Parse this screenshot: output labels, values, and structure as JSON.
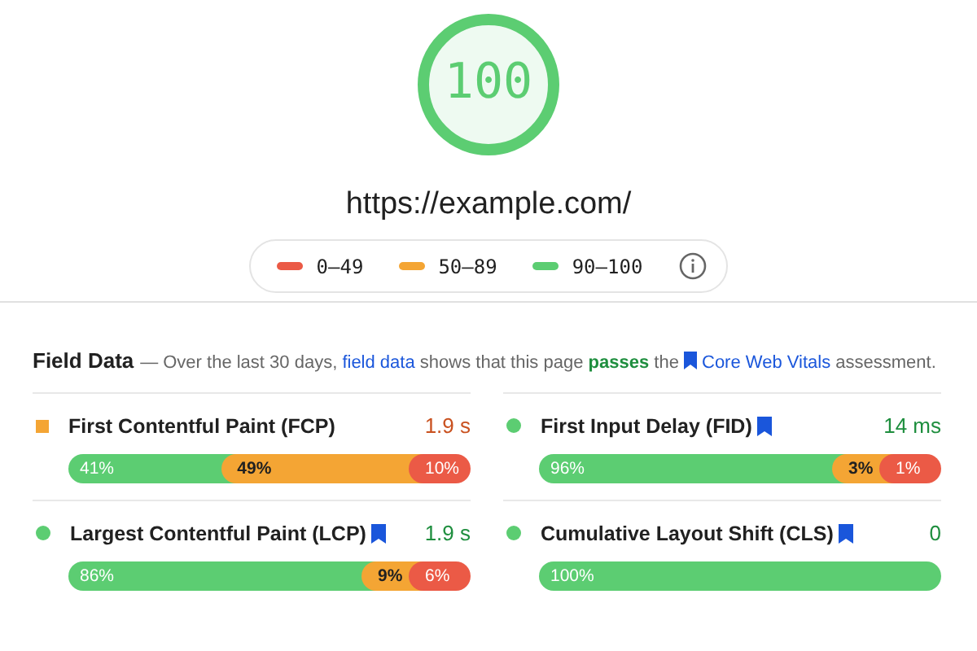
{
  "gauge": {
    "score": "100",
    "level": 1
  },
  "url": "https://example.com/",
  "legend": [
    {
      "label": "0–49",
      "color": "#eb5a46"
    },
    {
      "label": "50–89",
      "color": "#f4a534"
    },
    {
      "label": "90–100",
      "color": "#5ccd72"
    }
  ],
  "field_data": {
    "title": "Field Data",
    "dash": "—",
    "description": [
      {
        "kind": "text",
        "text": "Over the last 30 days,"
      },
      {
        "kind": "link",
        "text": "field data"
      },
      {
        "kind": "text",
        "text": "shows that this page"
      },
      {
        "kind": "pass",
        "text": "passes"
      },
      {
        "kind": "text",
        "text": "the"
      },
      {
        "kind": "cwv",
        "text": "Core Web Vitals"
      },
      {
        "kind": "text",
        "text": "assessment."
      }
    ]
  },
  "metrics": [
    {
      "name": "First Contentful Paint (FCP)",
      "kind": "average",
      "value": "1.9 s",
      "core": false,
      "segments": [
        {
          "kind": "fast",
          "label": "41%"
        },
        {
          "kind": "average",
          "label": "49%"
        },
        {
          "kind": "slow",
          "label": "10%"
        }
      ]
    },
    {
      "name": "First Input Delay (FID)",
      "kind": "fast",
      "value": "14 ms",
      "core": true,
      "segments": [
        {
          "kind": "fast",
          "label": "96%"
        },
        {
          "kind": "average",
          "label": "3%"
        },
        {
          "kind": "slow",
          "label": "1%"
        }
      ]
    },
    {
      "name": "Largest Contentful Paint (LCP)",
      "kind": "fast",
      "value": "1.9 s",
      "core": true,
      "segments": [
        {
          "kind": "fast",
          "label": "86%"
        },
        {
          "kind": "average",
          "label": "9%"
        },
        {
          "kind": "slow",
          "label": "6%"
        }
      ]
    },
    {
      "name": "Cumulative Layout Shift (CLS)",
      "kind": "fast",
      "value": "0",
      "core": true,
      "segments": [
        {
          "kind": "fast",
          "label": "100%"
        }
      ]
    }
  ]
}
